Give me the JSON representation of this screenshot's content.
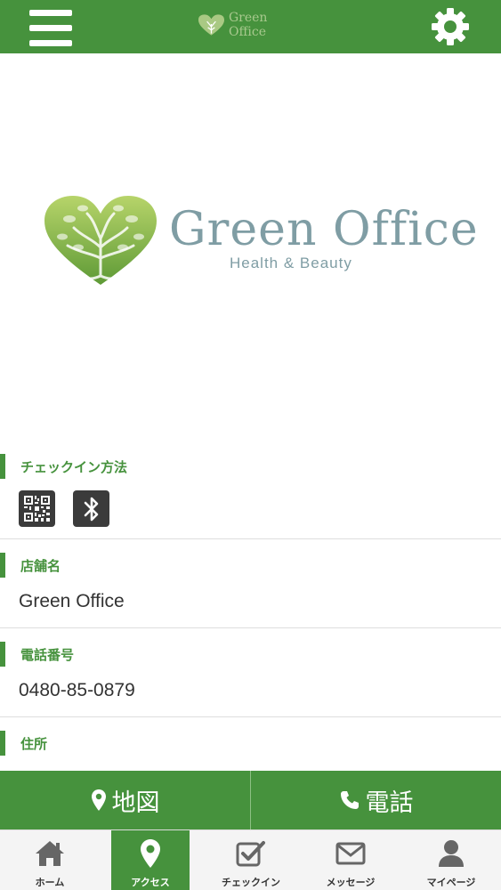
{
  "header": {
    "logo_text": "Green Office"
  },
  "hero": {
    "title": "Green Office",
    "subtitle": "Health & Beauty"
  },
  "sections": {
    "checkin": {
      "label": "チェックイン方法"
    },
    "shop": {
      "label": "店舗名",
      "value": "Green Office"
    },
    "phone": {
      "label": "電話番号",
      "value": "0480-85-0879"
    },
    "address": {
      "label": "住所"
    }
  },
  "actions": {
    "map_label": "地図",
    "call_label": "電話"
  },
  "tabs": [
    {
      "label": "ホーム",
      "icon": "home-icon"
    },
    {
      "label": "アクセス",
      "icon": "map-pin-icon",
      "active": true
    },
    {
      "label": "チェックイン",
      "icon": "checkbox-icon"
    },
    {
      "label": "メッセージ",
      "icon": "envelope-icon"
    },
    {
      "label": "マイページ",
      "icon": "user-icon"
    }
  ],
  "colors": {
    "brand_green": "#46923d",
    "logo_text": "#7f9da4",
    "tab_background": "#f4f4f4"
  }
}
